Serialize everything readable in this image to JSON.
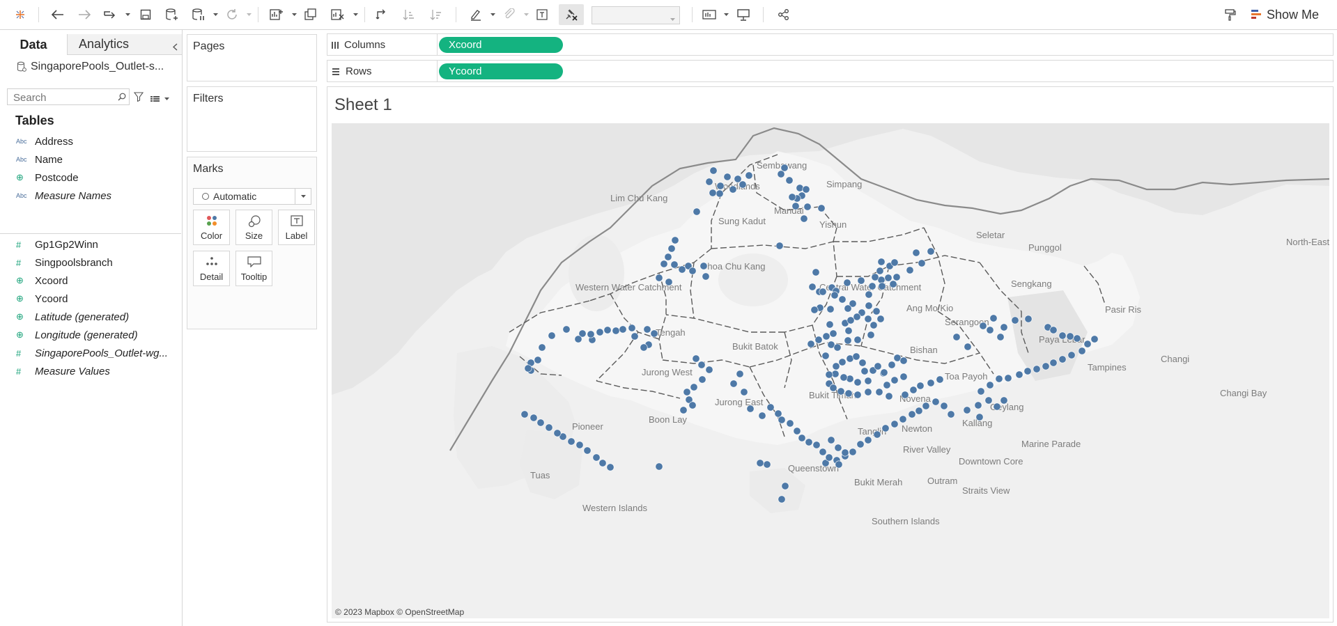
{
  "toolbar": {
    "show_me_label": "Show Me",
    "fit_value": ""
  },
  "data_pane": {
    "tab_data": "Data",
    "tab_analytics": "Analytics",
    "datasource": "SingaporePools_Outlet-s...",
    "search_placeholder": "Search",
    "tables_heading": "Tables",
    "fields": [
      {
        "name": "Address",
        "type": "Abc",
        "italic": false
      },
      {
        "name": "Name",
        "type": "Abc",
        "italic": false
      },
      {
        "name": "Postcode",
        "type": "geo",
        "italic": false
      },
      {
        "name": "Measure Names",
        "type": "Abc",
        "italic": true
      },
      {
        "name": "Gp1Gp2Winn",
        "type": "#",
        "italic": false
      },
      {
        "name": "Singpoolsbranch",
        "type": "#",
        "italic": false
      },
      {
        "name": "Xcoord",
        "type": "geo",
        "italic": false
      },
      {
        "name": "Ycoord",
        "type": "geo",
        "italic": false
      },
      {
        "name": "Latitude (generated)",
        "type": "geo",
        "italic": true
      },
      {
        "name": "Longitude (generated)",
        "type": "geo",
        "italic": true
      },
      {
        "name": "SingaporePools_Outlet-wg...",
        "type": "#",
        "italic": true
      },
      {
        "name": "Measure Values",
        "type": "#",
        "italic": true
      }
    ]
  },
  "cards": {
    "pages_title": "Pages",
    "filters_title": "Filters",
    "marks_title": "Marks",
    "marks_type": "Automatic",
    "marks_buttons": {
      "color": "Color",
      "size": "Size",
      "label": "Label",
      "detail": "Detail",
      "tooltip": "Tooltip"
    }
  },
  "shelves": {
    "columns_label": "Columns",
    "columns_pill": "Xcoord",
    "rows_label": "Rows",
    "rows_pill": "Ycoord"
  },
  "sheet": {
    "title": "Sheet 1",
    "attribution": "© 2023 Mapbox © OpenStreetMap",
    "place_labels": [
      "Sembawang",
      "Woodlands",
      "Simpang",
      "Mandai",
      "Yishun",
      "Lim Chu Kang",
      "Sung Kadut",
      "Seletar",
      "Punggol",
      "North-Eastern Islands",
      "Choa Chu Kang",
      "Western Water Catchment",
      "Central Water Catchment",
      "Sengkang",
      "Ang Mo Kio",
      "Serangoon",
      "Pasir Ris",
      "Tengah",
      "Bukit Batok",
      "Paya Lebar",
      "Changi",
      "Jurong West",
      "Bishan",
      "Tampines",
      "Toa Payoh",
      "Bukit Timah",
      "Jurong East",
      "Novena",
      "Changi Bay",
      "Geylang",
      "Boon Lay",
      "Pioneer",
      "Tanglin",
      "Newton",
      "Kallang",
      "Marine Parade",
      "River Valley",
      "Queenstown",
      "Downtown Core",
      "Tuas",
      "Bukit Merah",
      "Outram",
      "Straits View",
      "Western Islands",
      "Southern Islands"
    ],
    "mark_color": "#4e79a7",
    "accent_color": "#14b380"
  }
}
